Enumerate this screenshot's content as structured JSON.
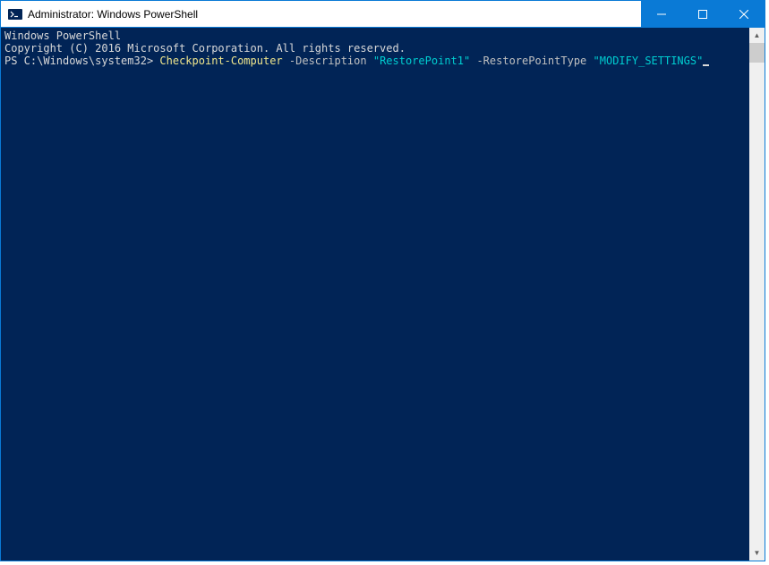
{
  "titlebar": {
    "title": "Administrator: Windows PowerShell"
  },
  "terminal": {
    "line1": "Windows PowerShell",
    "line2": "Copyright (C) 2016 Microsoft Corporation. All rights reserved.",
    "blank": "",
    "prompt": "PS C:\\Windows\\system32> ",
    "cmdlet": "Checkpoint-Computer",
    "sp1": " ",
    "param1": "-Description",
    "sp2": " ",
    "val1": "\"RestorePoint1\"",
    "sp3": " ",
    "param2": "-RestorePointType",
    "sp4": " ",
    "val2": "\"MODIFY_SETTINGS\""
  }
}
